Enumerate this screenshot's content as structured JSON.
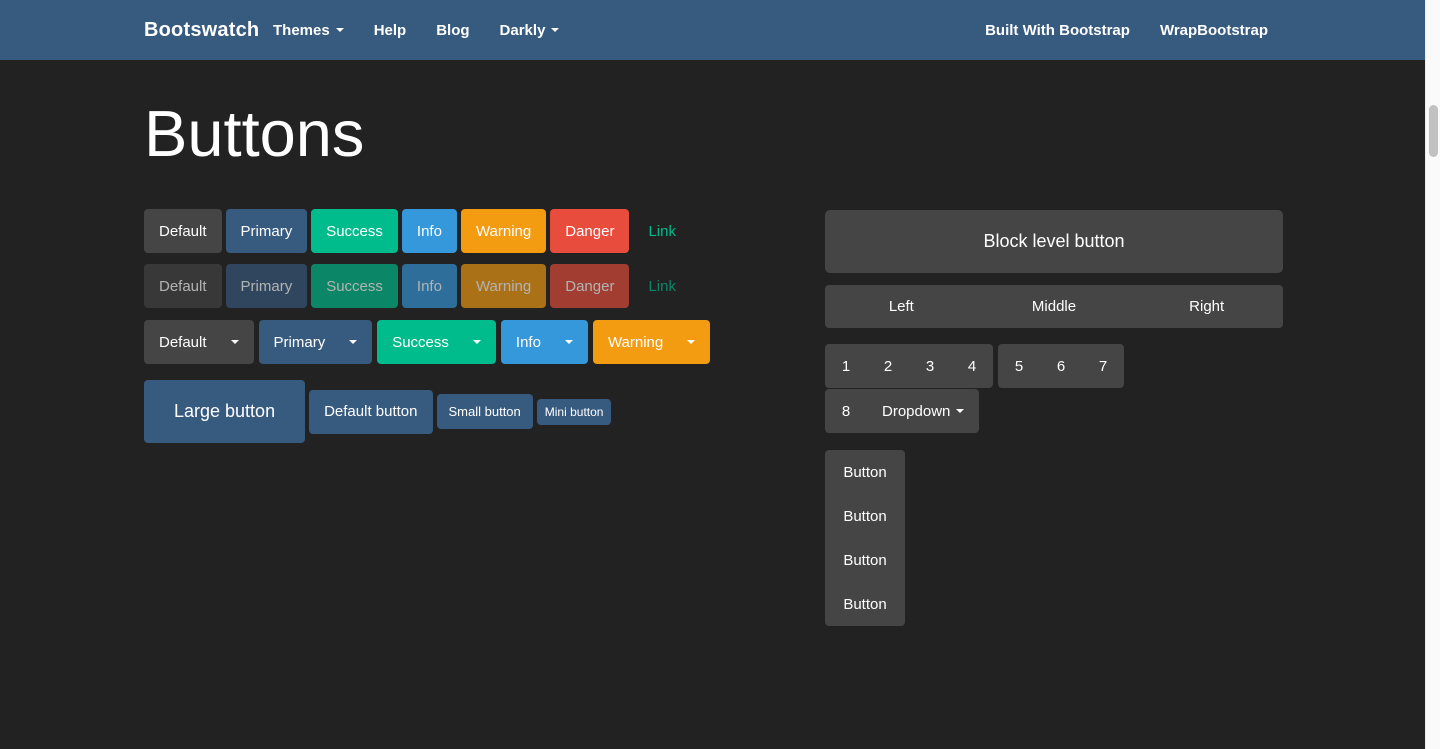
{
  "navbar": {
    "brand": "Bootswatch",
    "left_items": [
      "Themes",
      "Help",
      "Blog",
      "Darkly"
    ],
    "right_items": [
      "Built With Bootstrap",
      "WrapBootstrap"
    ]
  },
  "page": {
    "title": "Buttons"
  },
  "buttons": {
    "variants": [
      "Default",
      "Primary",
      "Success",
      "Info",
      "Warning",
      "Danger",
      "Link"
    ],
    "dropdowns": [
      "Default",
      "Primary",
      "Success",
      "Info",
      "Warning"
    ],
    "sizes": [
      "Large button",
      "Default button",
      "Small button",
      "Mini button"
    ]
  },
  "right_column": {
    "block_label": "Block level button",
    "justified": [
      "Left",
      "Middle",
      "Right"
    ],
    "toolbar_group1": [
      "1",
      "2",
      "3",
      "4"
    ],
    "toolbar_group2": [
      "5",
      "6",
      "7"
    ],
    "toolbar_group3_number": "8",
    "toolbar_group3_dropdown": "Dropdown",
    "vertical_group": [
      "Button",
      "Button",
      "Button",
      "Button"
    ]
  },
  "colors": {
    "bg": "#222222",
    "navbar": "#375a7f",
    "default": "#464545",
    "primary": "#375a7f",
    "success": "#00bc8c",
    "info": "#3498db",
    "warning": "#f39c12",
    "danger": "#e74c3c",
    "link": "#00bc8c",
    "text": "#ffffff"
  }
}
